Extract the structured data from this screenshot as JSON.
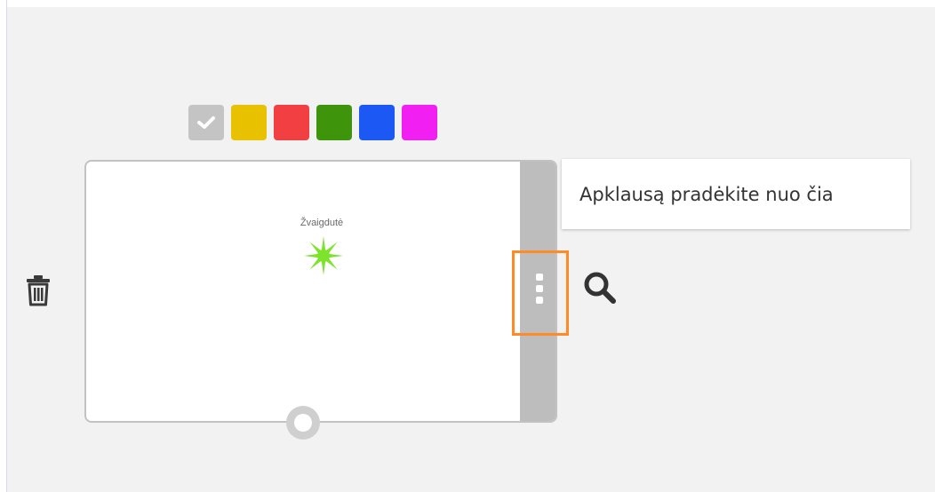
{
  "palette": {
    "swatches": [
      {
        "name": "gray",
        "color": "#c4c4c4",
        "selected": true
      },
      {
        "name": "yellow",
        "color": "#e8c200",
        "selected": false
      },
      {
        "name": "red",
        "color": "#f23f41",
        "selected": false
      },
      {
        "name": "green",
        "color": "#3e950c",
        "selected": false
      },
      {
        "name": "blue",
        "color": "#1b58f4",
        "selected": false
      },
      {
        "name": "magenta",
        "color": "#f21ff2",
        "selected": false
      }
    ],
    "check_icon": "check-icon"
  },
  "node": {
    "title": "Žvaigdutė",
    "icon": "star-burst-icon",
    "icon_color": "#7de32c"
  },
  "controls": {
    "menu_icon": "vertical-dots-icon",
    "search_icon": "search-icon",
    "trash_icon": "trash-icon",
    "connector": "connector-handle",
    "highlight_color": "#ff8a26"
  },
  "tooltip": {
    "text": "Apklausą pradėkite nuo čia"
  }
}
